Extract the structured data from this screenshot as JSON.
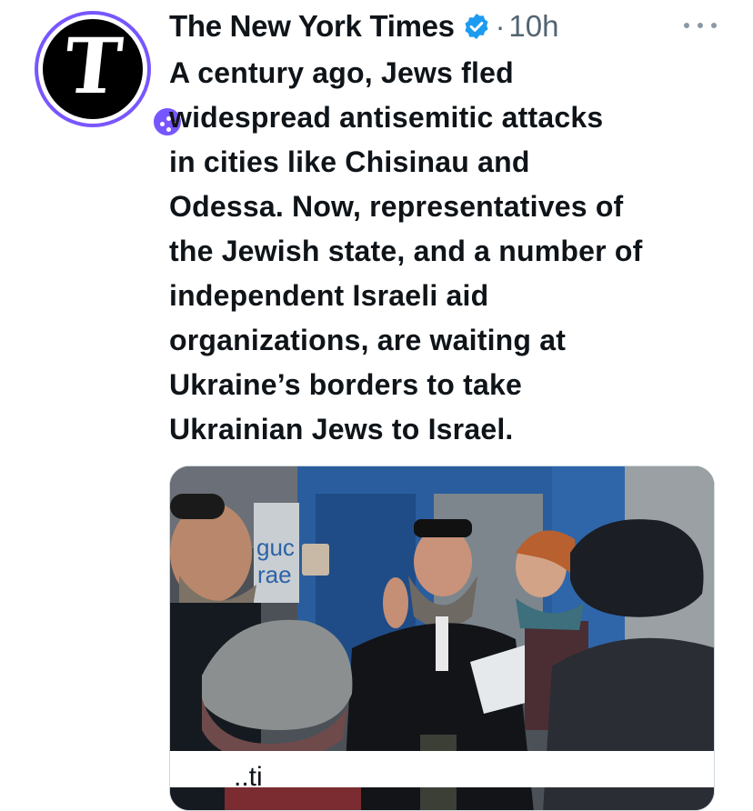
{
  "account": {
    "name": "The New York Times",
    "separator": "·",
    "time": "10h",
    "avatar_letter": "T",
    "avatar_ring_color": "#7856ff",
    "verified_color": "#1d9bf0"
  },
  "icons": {
    "verified": "verified-badge-icon",
    "more": "more-options-icon",
    "affiliate": "affiliate-badge-icon"
  },
  "tweet": {
    "lines": [
      "A century ago, Jews fled",
      "widespread antisemitic attacks",
      "in cities like Chisinau and",
      "Odessa. Now, representatives of",
      "the Jewish state, and a number of",
      "independent Israeli aid",
      "organizations, are waiting at",
      "Ukraine’s borders to take",
      "Ukrainian Jews to Israel."
    ]
  },
  "media": {
    "sign_fragments": [
      "guc",
      "rae"
    ],
    "card_title_fragment": "..ti"
  }
}
